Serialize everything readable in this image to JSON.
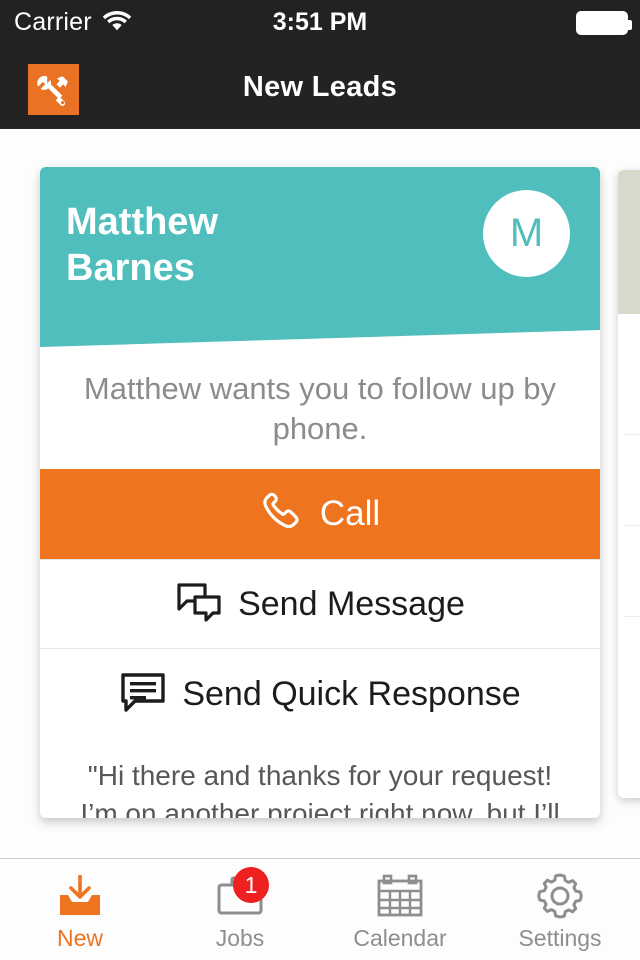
{
  "status_bar": {
    "carrier": "Carrier",
    "wifi_icon": "wifi-icon",
    "time": "3:51 PM",
    "battery_icon": "battery-full-icon"
  },
  "nav_bar": {
    "logo_icon": "tools-hammer-wrench-logo",
    "title": "New Leads"
  },
  "lead_card": {
    "name": "Matthew\nBarnes",
    "name_line1": "Matthew",
    "name_line2": "Barnes",
    "avatar_initial": "M",
    "summary": "Matthew wants you to follow up by phone.",
    "call": {
      "label": "Call",
      "icon": "phone-handset-icon"
    },
    "send_message": {
      "label": "Send Message",
      "icon": "chat-bubbles-icon"
    },
    "quick_response": {
      "label": "Send Quick Response",
      "icon": "message-lines-icon",
      "text": "\"Hi there and thanks for your request! I’m on another project right now, but I’ll get back to you later this evening.\""
    }
  },
  "tab_bar": {
    "items": [
      {
        "label": "New",
        "icon": "inbox-download-icon",
        "active": true,
        "badge": ""
      },
      {
        "label": "Jobs",
        "icon": "briefcase-icon",
        "active": false,
        "badge": "1"
      },
      {
        "label": "Calendar",
        "icon": "calendar-icon",
        "active": false,
        "badge": ""
      },
      {
        "label": "Settings",
        "icon": "gear-icon",
        "active": false,
        "badge": ""
      }
    ]
  },
  "colors": {
    "accent_orange": "#ee7420",
    "teal": "#4fbebd",
    "nav_dark": "#232323",
    "badge_red": "#ee2020",
    "next_card_header": "#d9d9cb"
  }
}
